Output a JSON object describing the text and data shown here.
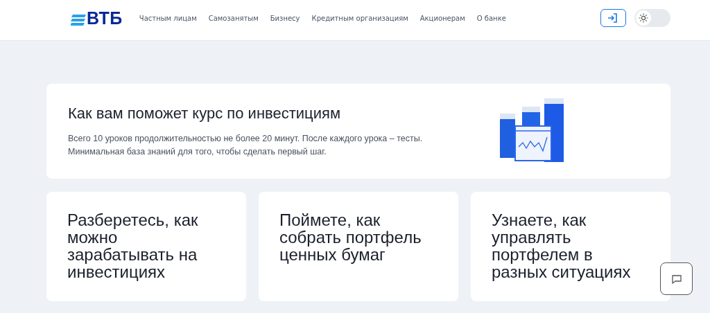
{
  "header": {
    "logo": "ВТБ",
    "nav": [
      {
        "label": "Частным лицам"
      },
      {
        "label": "Самозанятым"
      },
      {
        "label": "Бизнесу"
      },
      {
        "label": "Кредитным организациям"
      },
      {
        "label": "Акционерам"
      },
      {
        "label": "О банке"
      }
    ],
    "theme_toggle": {
      "on": false
    }
  },
  "intro": {
    "title": "Как вам поможет курс по инвестициям",
    "text": "Всего 10 уроков продолжительностью не более 20 минут. После каждого урока – тесты. Минимальная база знаний для того, чтобы сделать первый шаг."
  },
  "benefits": [
    {
      "text": "Разберетесь, как можно зарабатывать на инвестициях"
    },
    {
      "text": "Поймете, как собрать портфель ценных бумаг"
    },
    {
      "text": "Узнаете, как управлять портфелем в разных ситуациях"
    }
  ]
}
